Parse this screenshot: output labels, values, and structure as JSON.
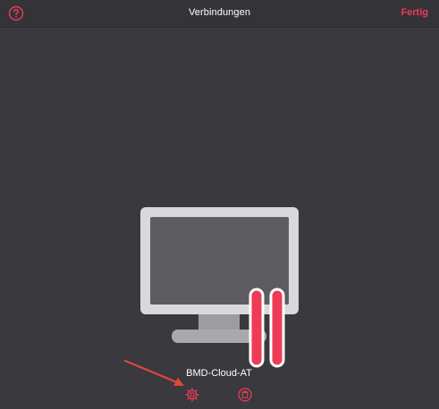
{
  "navbar": {
    "title": "Verbindungen",
    "done_label": "Fertig",
    "help_icon": "question-circle-icon"
  },
  "connection": {
    "name": "BMD-Cloud-AT",
    "thumbnail_icon": "monitor-icon",
    "settings_icon": "gear-icon",
    "delete_icon": "trash-icon"
  },
  "colors": {
    "background": "#3a393d",
    "navbar": "#343337",
    "accent": "#ee3b56",
    "monitor_frame": "#d9d9db",
    "monitor_screen": "#5d5c60",
    "annotation": "#e0483c"
  }
}
